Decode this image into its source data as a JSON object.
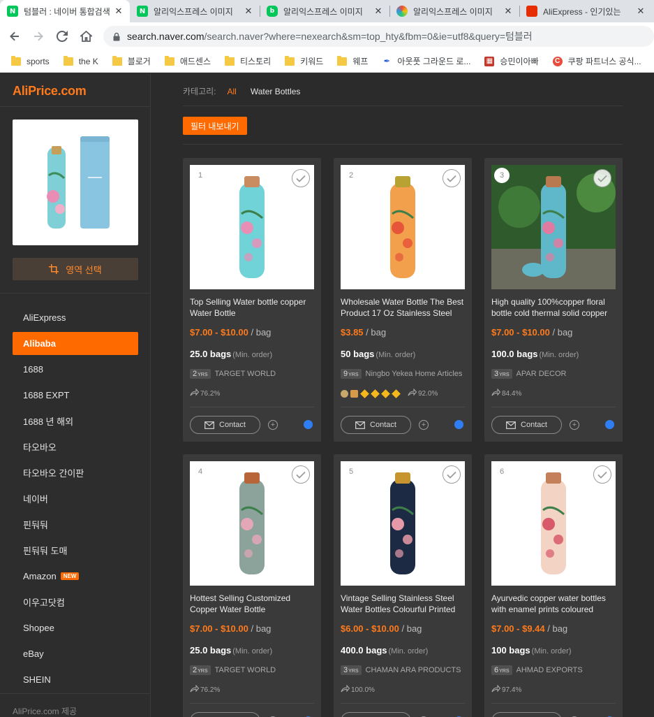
{
  "browser": {
    "tabs": [
      {
        "title": "텀블러 : 네이버 통합검색",
        "favicon": "N",
        "favicon_color": "#03c75a",
        "active": true
      },
      {
        "title": "알리익스프레스 이미지",
        "favicon": "N",
        "favicon_color": "#03c75a",
        "active": false
      },
      {
        "title": "알리익스프레스 이미지",
        "favicon": "blog",
        "favicon_color": "#03c75a",
        "active": false
      },
      {
        "title": "알리익스프레스 이미지",
        "favicon": "rainbow",
        "favicon_color": "#e84c3d",
        "active": false
      },
      {
        "title": "AliExpress - 인기있는",
        "favicon": "ali",
        "favicon_color": "#e62e04",
        "active": false
      }
    ],
    "url_host": "search.naver.com",
    "url_rest": "/search.naver?where=nexearch&sm=top_hty&fbm=0&ie=utf8&query=텀블러",
    "bookmarks": [
      {
        "label": "sports",
        "icon": "folder"
      },
      {
        "label": "the K",
        "icon": "folder"
      },
      {
        "label": "블로거",
        "icon": "folder"
      },
      {
        "label": "애드센스",
        "icon": "folder"
      },
      {
        "label": "티스토리",
        "icon": "folder"
      },
      {
        "label": "키워드",
        "icon": "folder"
      },
      {
        "label": "웨프",
        "icon": "folder"
      },
      {
        "label": "아웃풋 그라운드 로...",
        "icon": "feather"
      },
      {
        "label": "승민이아빠",
        "icon": "grid"
      },
      {
        "label": "쿠팡 파트너스 공식...",
        "icon": "coupang"
      }
    ]
  },
  "sidebar": {
    "logo": "AliPrice.com",
    "region_button": "영역 선택",
    "items": [
      {
        "label": "AliExpress",
        "active": false
      },
      {
        "label": "Alibaba",
        "active": true
      },
      {
        "label": "1688",
        "active": false
      },
      {
        "label": "1688 EXPT",
        "active": false
      },
      {
        "label": "1688 년 해외",
        "active": false
      },
      {
        "label": "타오바오",
        "active": false
      },
      {
        "label": "타오바오 간이판",
        "active": false
      },
      {
        "label": "네이버",
        "active": false
      },
      {
        "label": "핀둬둬",
        "active": false
      },
      {
        "label": "핀둬둬 도매",
        "active": false
      },
      {
        "label": "Amazon",
        "active": false,
        "badge": "NEW"
      },
      {
        "label": "이우고닷컴",
        "active": false
      },
      {
        "label": "Shopee",
        "active": false
      },
      {
        "label": "eBay",
        "active": false
      },
      {
        "label": "SHEIN",
        "active": false
      }
    ],
    "footer": "AliPrice.com 제공"
  },
  "main": {
    "category_label": "카테고리:",
    "category_all": "All",
    "category_value": "Water Bottles",
    "filter_button": "필터 내보내기",
    "contact_label": "Contact",
    "moq_label": "(Min. order)",
    "yrs_label": "YRS",
    "products": [
      {
        "num": "1",
        "title": "Top Selling Water bottle copper Water Bottle",
        "price": "$7.00 - $10.00",
        "unit": "/ bag",
        "moq": "25.0 bags",
        "years": "2",
        "supplier": "TARGET WORLD",
        "rate": "76.2%",
        "badges": false,
        "colors": {
          "body": "#6fd3d8",
          "accent": "#e88fb8",
          "cap": "#c98b60"
        }
      },
      {
        "num": "2",
        "title": "Wholesale Water Bottle The Best Product 17 Oz Stainless Steel",
        "price": "$3.85",
        "unit": "/ bag",
        "moq": "50 bags",
        "years": "9",
        "supplier": "Ningbo Yekea Home Articles",
        "rate": "92.0%",
        "badges": true,
        "colors": {
          "body": "#f2a04b",
          "accent": "#e6553a",
          "cap": "#b8a233"
        }
      },
      {
        "num": "3",
        "title": "High quality 100%copper floral bottle cold thermal solid copper",
        "price": "$7.00 - $10.00",
        "unit": "/ bag",
        "moq": "100.0 bags",
        "years": "3",
        "supplier": "APAR DECOR",
        "rate": "84.4%",
        "badges": false,
        "colors": {
          "body": "#5fb8c9",
          "accent": "#e07aa0",
          "cap": "#b87850"
        }
      },
      {
        "num": "4",
        "title": "Hottest Selling Customized Copper Water Bottle",
        "price": "$7.00 - $10.00",
        "unit": "/ bag",
        "moq": "25.0 bags",
        "years": "2",
        "supplier": "TARGET WORLD",
        "rate": "76.2%",
        "badges": false,
        "colors": {
          "body": "#8ba39a",
          "accent": "#e4a7b8",
          "cap": "#b8653a"
        }
      },
      {
        "num": "5",
        "title": "Vintage Selling Stainless Steel Water Bottles Colourful Printed",
        "price": "$6.00 - $10.00",
        "unit": "/ bag",
        "moq": "400.0 bags",
        "years": "3",
        "supplier": "CHAMAN ARA PRODUCTS",
        "rate": "100.0%",
        "badges": false,
        "colors": {
          "body": "#1d2a44",
          "accent": "#e69aa8",
          "cap": "#c7952f"
        }
      },
      {
        "num": "6",
        "title": "Ayurvedic copper water bottles with enamel prints coloured",
        "price": "$7.00 - $9.44",
        "unit": "/ bag",
        "moq": "100 bags",
        "years": "6",
        "supplier": "AHMAD EXPORTS",
        "rate": "97.4%",
        "badges": false,
        "colors": {
          "body": "#f2d3c4",
          "accent": "#d85a6a",
          "cap": "#c4805a"
        }
      }
    ]
  }
}
